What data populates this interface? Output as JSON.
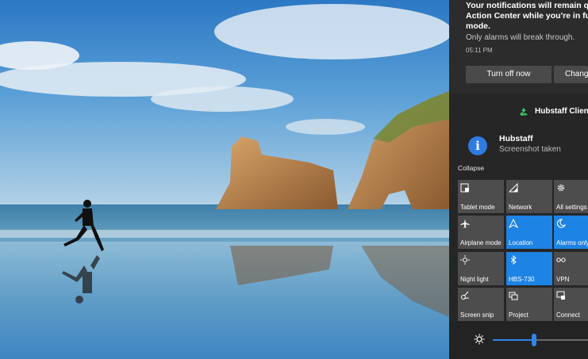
{
  "notification": {
    "message": "Your notifications will remain quie\nAction Center while you're in full s\nmode.",
    "subtext": "Only alarms will break through.",
    "time": "05:11 PM",
    "turn_off_label": "Turn off now",
    "change_label": "Change"
  },
  "app_group": {
    "name": "Hubstaff Client",
    "icon": "recycle-icon"
  },
  "hubstaff_notification": {
    "title": "Hubstaff",
    "subtitle": "Screenshot taken",
    "icon": "info-icon"
  },
  "collapse_label": "Collapse",
  "quick_actions": [
    {
      "label": "Tablet mode",
      "icon": "tablet-mode-icon",
      "active": false
    },
    {
      "label": "Network",
      "icon": "network-icon",
      "active": false
    },
    {
      "label": "All settings",
      "icon": "gear-icon",
      "active": false
    },
    {
      "label": "Airplane mode",
      "icon": "airplane-icon",
      "active": false
    },
    {
      "label": "Location",
      "icon": "location-icon",
      "active": true
    },
    {
      "label": "Alarms only",
      "icon": "moon-icon",
      "active": true
    },
    {
      "label": "Night light",
      "icon": "sun-icon",
      "active": false
    },
    {
      "label": "HBS-730",
      "icon": "bluetooth-icon",
      "active": true
    },
    {
      "label": "VPN",
      "icon": "vpn-icon",
      "active": false
    },
    {
      "label": "Screen snip",
      "icon": "scissors-icon",
      "active": false
    },
    {
      "label": "Project",
      "icon": "project-icon",
      "active": false
    },
    {
      "label": "Connect",
      "icon": "connect-icon",
      "active": false
    }
  ],
  "brightness": {
    "level": 0.4,
    "icon": "brightness-icon"
  },
  "colors": {
    "accent": "#1d83e4",
    "tile": "#4d4d4d",
    "panel": "#262626"
  }
}
